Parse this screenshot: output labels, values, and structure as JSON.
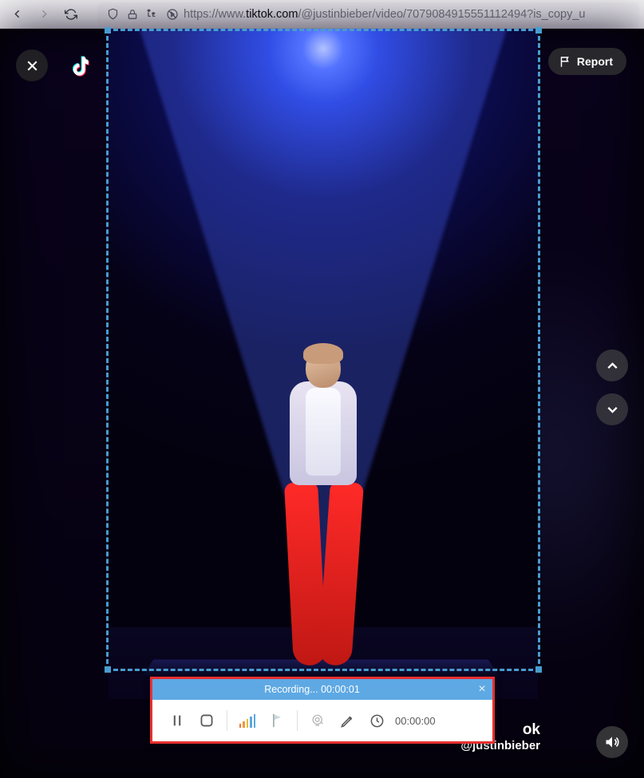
{
  "browser": {
    "url_prefix": "https://www.",
    "url_host": "tiktok.com",
    "url_path": "/@justinbieber/video/7079084915551112494?is_copy_u"
  },
  "overlay": {
    "report_label": "Report",
    "watermark_brand": "ok",
    "watermark_handle": "@justinbieber"
  },
  "recorder": {
    "title_label": "Recording...",
    "title_elapsed": "00:00:01",
    "duration": "00:00:00"
  }
}
